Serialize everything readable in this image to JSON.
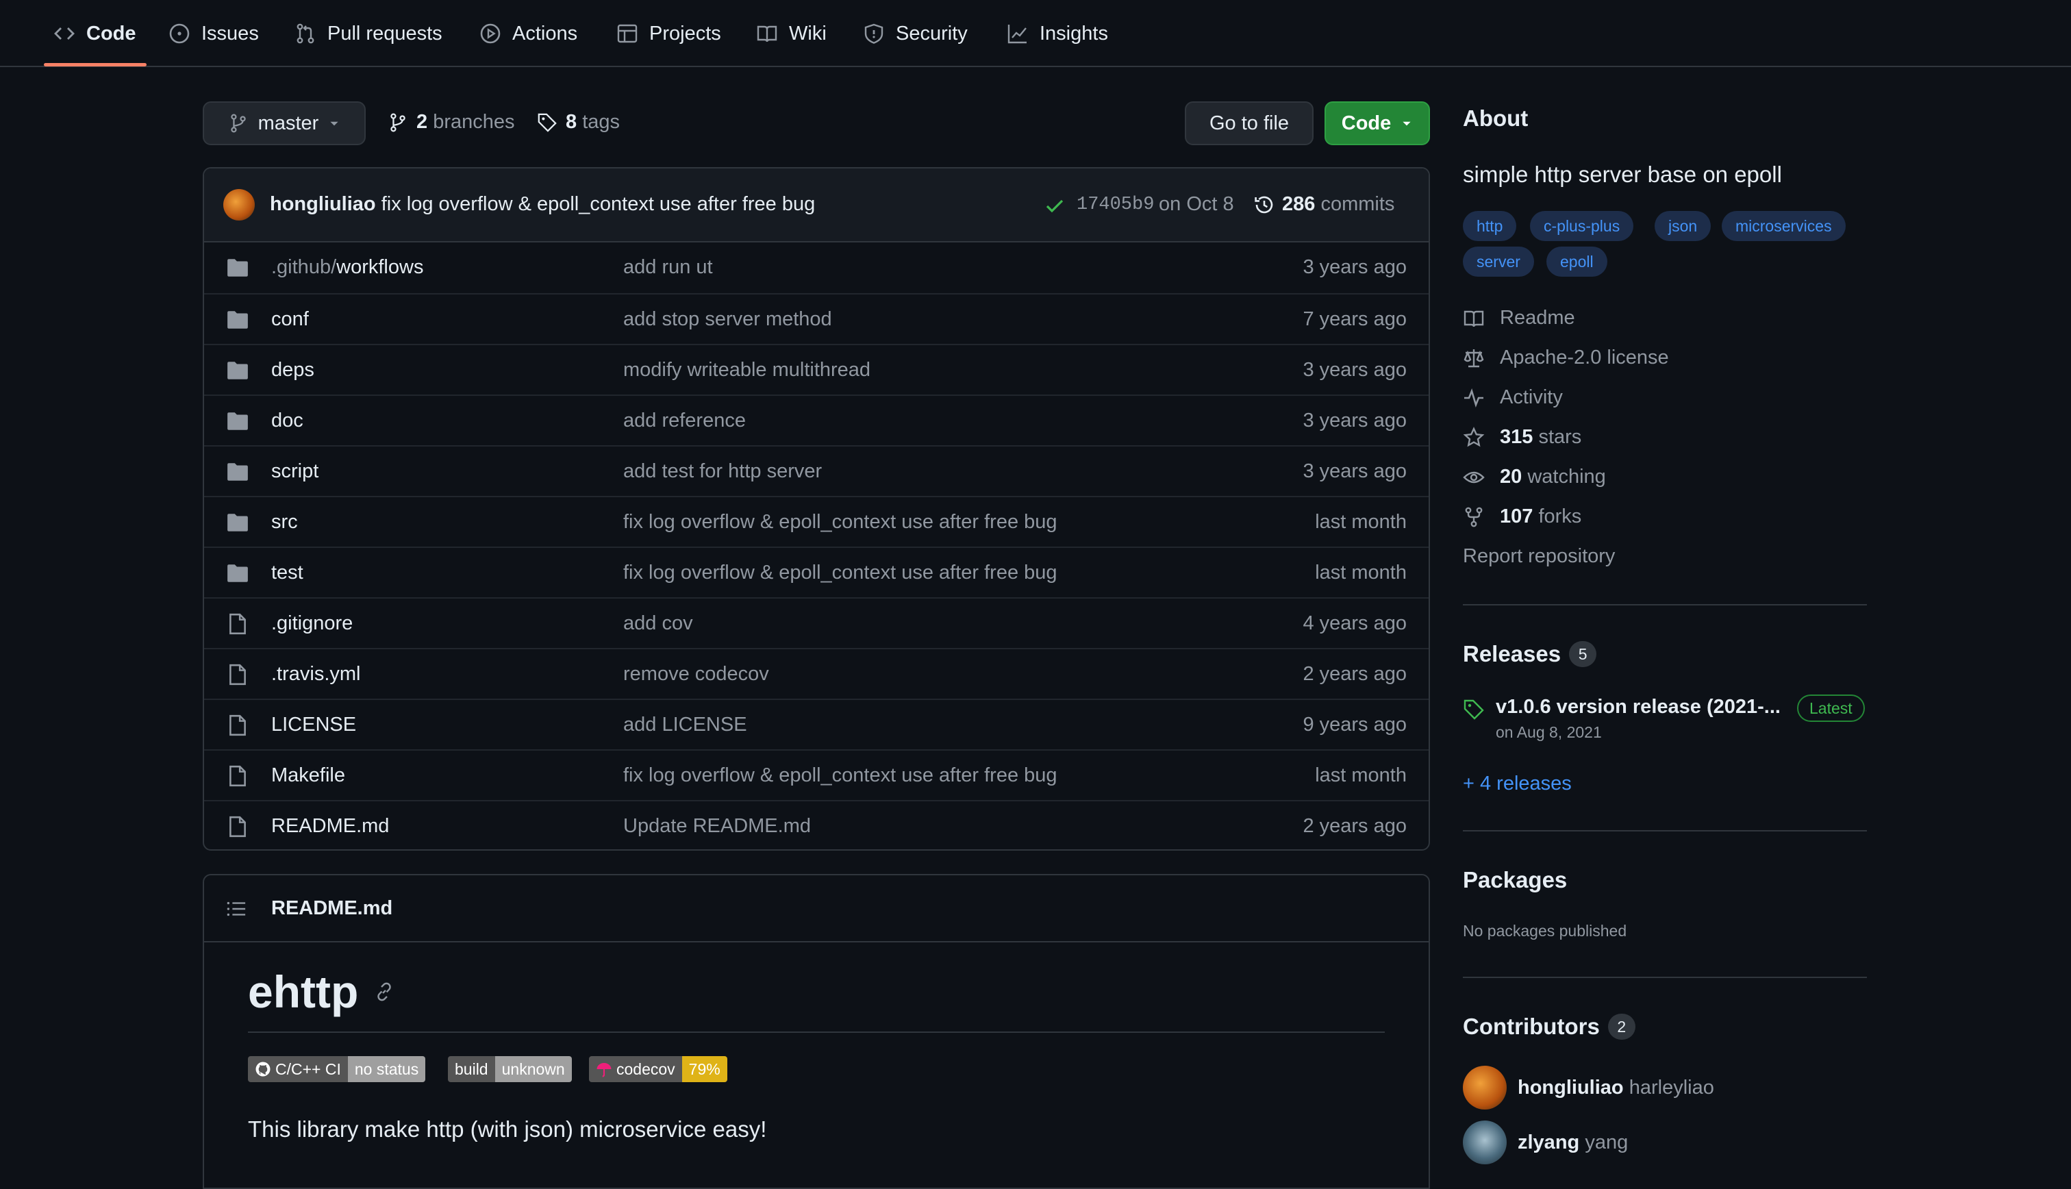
{
  "nav": {
    "tabs": [
      {
        "label": "Code",
        "icon": "code-icon"
      },
      {
        "label": "Issues",
        "icon": "issue-opened-icon"
      },
      {
        "label": "Pull requests",
        "icon": "git-pull-request-icon"
      },
      {
        "label": "Actions",
        "icon": "play-icon"
      },
      {
        "label": "Projects",
        "icon": "table-icon"
      },
      {
        "label": "Wiki",
        "icon": "book-icon"
      },
      {
        "label": "Security",
        "icon": "shield-icon"
      },
      {
        "label": "Insights",
        "icon": "graph-icon"
      }
    ],
    "active": "Code"
  },
  "repo": {
    "branch": "master",
    "branches_count": "2",
    "branches_label": "branches",
    "tags_count": "8",
    "tags_label": "tags",
    "go_to_file": "Go to file",
    "code_button": "Code"
  },
  "commit": {
    "author": "hongliuliao",
    "message": "fix log overflow & epoll_context use after free bug",
    "sha": "17405b9",
    "date": "on Oct 8",
    "commits_count": "286",
    "commits_label": "commits"
  },
  "files": [
    {
      "type": "dir",
      "prefix": ".github/",
      "name": "workflows",
      "message": "add run ut",
      "time": "3 years ago"
    },
    {
      "type": "dir",
      "prefix": "",
      "name": "conf",
      "message": "add stop server method",
      "time": "7 years ago"
    },
    {
      "type": "dir",
      "prefix": "",
      "name": "deps",
      "message": "modify writeable multithread",
      "time": "3 years ago"
    },
    {
      "type": "dir",
      "prefix": "",
      "name": "doc",
      "message": "add reference",
      "time": "3 years ago"
    },
    {
      "type": "dir",
      "prefix": "",
      "name": "script",
      "message": "add test for http server",
      "time": "3 years ago"
    },
    {
      "type": "dir",
      "prefix": "",
      "name": "src",
      "message": "fix log overflow & epoll_context use after free bug",
      "time": "last month"
    },
    {
      "type": "dir",
      "prefix": "",
      "name": "test",
      "message": "fix log overflow & epoll_context use after free bug",
      "time": "last month"
    },
    {
      "type": "file",
      "prefix": "",
      "name": ".gitignore",
      "message": "add cov",
      "time": "4 years ago"
    },
    {
      "type": "file",
      "prefix": "",
      "name": ".travis.yml",
      "message": "remove codecov",
      "time": "2 years ago"
    },
    {
      "type": "file",
      "prefix": "",
      "name": "LICENSE",
      "message": "add LICENSE",
      "time": "9 years ago"
    },
    {
      "type": "file",
      "prefix": "",
      "name": "Makefile",
      "message": "fix log overflow & epoll_context use after free bug",
      "time": "last month"
    },
    {
      "type": "file",
      "prefix": "",
      "name": "README.md",
      "message": "Update README.md",
      "time": "2 years ago"
    }
  ],
  "readme": {
    "filename": "README.md",
    "title": "ehttp",
    "badges": [
      {
        "left": "C/C++ CI",
        "right": "no status",
        "right_color": "#9f9f9f"
      },
      {
        "left": "build",
        "right": "unknown",
        "right_color": "#9f9f9f"
      },
      {
        "left": "codecov",
        "right": "79%",
        "right_color": "#dfb317"
      }
    ],
    "intro": "This library make http (with json) microservice easy!"
  },
  "about": {
    "heading": "About",
    "description": "simple http server base on epoll",
    "topics": [
      "http",
      "c-plus-plus",
      "json",
      "microservices",
      "server",
      "epoll"
    ],
    "readme": "Readme",
    "license": "Apache-2.0 license",
    "activity": "Activity",
    "stars_count": "315",
    "stars_label": "stars",
    "watching_count": "20",
    "watching_label": "watching",
    "forks_count": "107",
    "forks_label": "forks",
    "report": "Report repository"
  },
  "releases": {
    "heading": "Releases",
    "count": "5",
    "latest_title": "v1.0.6 version release (2021-...",
    "latest_badge": "Latest",
    "latest_date": "on Aug 8, 2021",
    "more": "+ 4 releases"
  },
  "packages": {
    "heading": "Packages",
    "empty": "No packages published"
  },
  "contributors": {
    "heading": "Contributors",
    "count": "2",
    "people": [
      {
        "login": "hongliuliao",
        "name": "harleyliao"
      },
      {
        "login": "zlyang",
        "name": "yang"
      }
    ]
  },
  "colors": {
    "background": "#0d1117",
    "accent": "#f78166",
    "green": "#238636",
    "link": "#4493f8"
  }
}
